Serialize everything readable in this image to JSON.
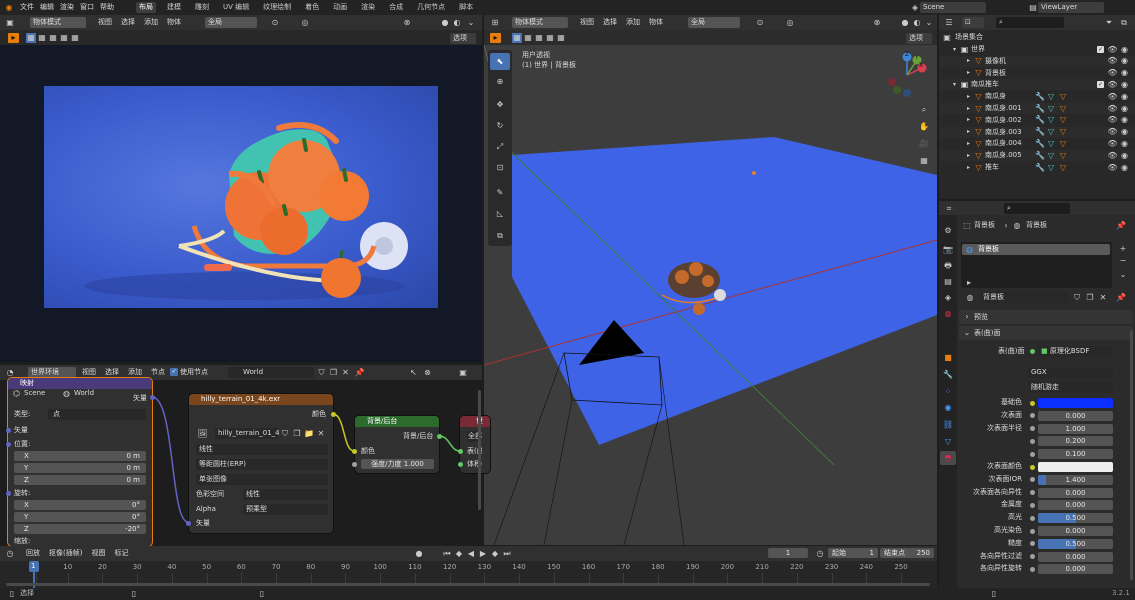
{
  "topbar": {
    "menus": [
      "文件",
      "编辑",
      "渲染",
      "窗口",
      "帮助"
    ],
    "workspaces": [
      "布局",
      "建模",
      "雕刻",
      "UV 编辑",
      "纹理绘制",
      "着色",
      "动画",
      "渲染",
      "合成",
      "几何节点",
      "脚本"
    ],
    "active_workspace": "布局",
    "scene": "Scene",
    "view_layer": "ViewLayer"
  },
  "render_editor": {
    "mode": "物体模式",
    "menus": [
      "视图",
      "选择",
      "添加",
      "物体"
    ],
    "transform": "全局",
    "options": "选项"
  },
  "viewport": {
    "mode": "物体模式",
    "menus": [
      "视图",
      "选择",
      "添加",
      "物体"
    ],
    "transform": "全局",
    "options": "选项",
    "overlay_title": "用户透视",
    "overlay_subtitle": "(1) 世界 | 背景板",
    "gizmo_axes": [
      "X",
      "Y",
      "Z"
    ]
  },
  "node_editor": {
    "header": {
      "shader_type": "世界环境",
      "menus": [
        "视图",
        "选择",
        "添加",
        "节点"
      ],
      "use_nodes": "使用节点",
      "world": "World"
    },
    "mapping": {
      "title": "映射",
      "scene": "Scene",
      "world": "World",
      "out_vector": "矢量",
      "type_label": "类型:",
      "type_value": "点",
      "in_vector": "矢量",
      "location": "位置:",
      "loc": [
        {
          "axis": "X",
          "val": "0 m"
        },
        {
          "axis": "Y",
          "val": "0 m"
        },
        {
          "axis": "Z",
          "val": "0 m"
        }
      ],
      "rotation": "旋转:",
      "rot": [
        {
          "axis": "X",
          "val": "0°"
        },
        {
          "axis": "Y",
          "val": "0°"
        },
        {
          "axis": "Z",
          "val": "-20°"
        }
      ],
      "scale": "缩放:"
    },
    "image": {
      "title": "hilly_terrain_01_4k.exr",
      "out_color": "颜色",
      "image_name": "hilly_terrain_01_4...",
      "interp": "线性",
      "projection": "等距圆柱(ERP)",
      "source": "单张图像",
      "colorspace_label": "色彩空间",
      "colorspace": "线性",
      "alpha_label": "Alpha",
      "alpha": "预乘型",
      "in_vector": "矢量"
    },
    "background": {
      "title": "背景/后台",
      "out": "背景/后台",
      "color": "颜色",
      "strength_label": "强度/力度",
      "strength": "1.000"
    },
    "output": {
      "title": "世",
      "p1": "全部",
      "p2": "表(曲",
      "p3": "体积("
    }
  },
  "outliner": {
    "title": "场景集合",
    "items": [
      {
        "label": "世界",
        "indent": 0
      },
      {
        "label": "摄像机",
        "indent": 1
      },
      {
        "label": "背景板",
        "indent": 1
      },
      {
        "label": "南瓜推车",
        "indent": 0
      },
      {
        "label": "南瓜身",
        "indent": 1
      },
      {
        "label": "南瓜身.001",
        "indent": 1
      },
      {
        "label": "南瓜身.002",
        "indent": 1
      },
      {
        "label": "南瓜身.003",
        "indent": 1
      },
      {
        "label": "南瓜身.004",
        "indent": 1
      },
      {
        "label": "南瓜身.005",
        "indent": 1
      },
      {
        "label": "推车",
        "indent": 1
      }
    ]
  },
  "properties": {
    "breadcrumb": [
      "背景板",
      "背景板"
    ],
    "slot": "背景板",
    "material": "背景板",
    "preview": "预览",
    "surface_panel": "表(曲)面",
    "surface_label": "表(曲)面",
    "surface_value": "原理化BSDF",
    "distribution": "GGX",
    "subsurface_method": "随机游走",
    "rows": [
      {
        "label": "基础色",
        "type": "color",
        "color": "#0a2fff"
      },
      {
        "label": "次表面",
        "type": "num",
        "value": "0.000",
        "fill": 0
      },
      {
        "label": "次表面半径",
        "type": "num",
        "value": "1.000",
        "fill": 0
      },
      {
        "label": "",
        "type": "num",
        "value": "0.200",
        "fill": 0
      },
      {
        "label": "",
        "type": "num",
        "value": "0.100",
        "fill": 0
      },
      {
        "label": "次表面颜色",
        "type": "color",
        "color": "#eeeeee"
      },
      {
        "label": "次表面IOR",
        "type": "num",
        "value": "1.400",
        "fill": 0.1
      },
      {
        "label": "次表面各向异性",
        "type": "num",
        "value": "0.000",
        "fill": 0
      },
      {
        "label": "金属度",
        "type": "num",
        "value": "0.000",
        "fill": 0
      },
      {
        "label": "高光",
        "type": "num",
        "value": "0.500",
        "fill": 0.5
      },
      {
        "label": "高光染色",
        "type": "num",
        "value": "0.000",
        "fill": 0
      },
      {
        "label": "糙度",
        "type": "num",
        "value": "0.500",
        "fill": 0.5
      },
      {
        "label": "各向异性过滤",
        "type": "num",
        "value": "0.000",
        "fill": 0
      },
      {
        "label": "各向异性旋转",
        "type": "num",
        "value": "0.000",
        "fill": 0
      }
    ]
  },
  "timeline": {
    "menus": [
      "回放",
      "抠像(插帧)",
      "视图",
      "标记"
    ],
    "current_frame": "1",
    "start_label": "起始",
    "start": "1",
    "end_label": "结束点",
    "end": "250",
    "ticks": [
      "1",
      "10",
      "20",
      "30",
      "40",
      "50",
      "60",
      "70",
      "80",
      "90",
      "100",
      "110",
      "120",
      "130",
      "140",
      "150",
      "160",
      "170",
      "180",
      "190",
      "200",
      "210",
      "220",
      "230",
      "240",
      "250"
    ]
  },
  "statusbar": {
    "left": "选择",
    "version": "3.2.1"
  }
}
